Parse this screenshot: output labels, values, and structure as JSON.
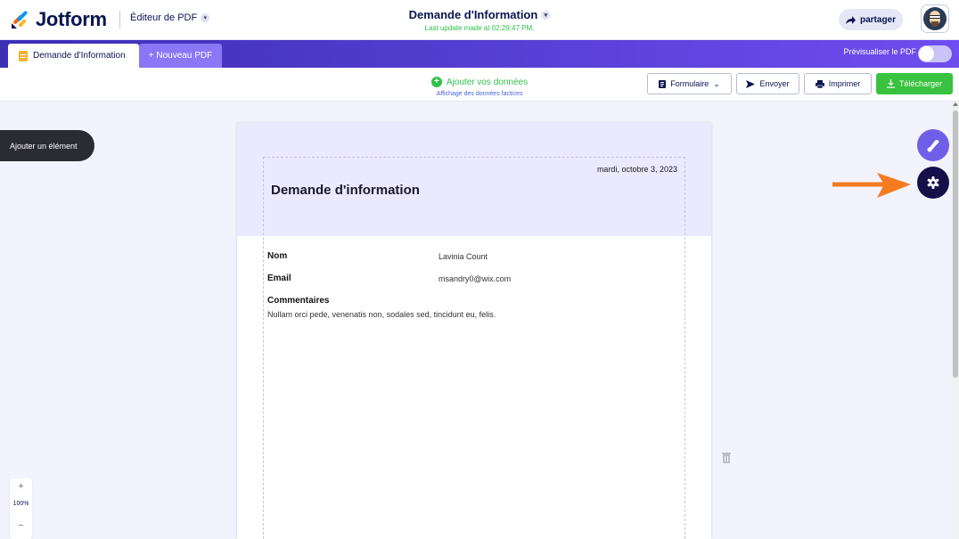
{
  "header": {
    "logo_text": "Jotform",
    "product": "Éditeur de PDF",
    "doc_title": "Demande d'Information",
    "last_update": "Last update made at 02:29:47 PM.",
    "share_label": "partager"
  },
  "tabs": {
    "active_label": "Demande d'Information",
    "new_label": "+ Nouveau PDF",
    "preview_label": "Prévisualiser le PDF"
  },
  "toolbar": {
    "add_data": "Ajouter vos données",
    "fake_data": "Affichage des données factices",
    "form_label": "Formulaire",
    "send_label": "Envoyer",
    "print_label": "Imprimer",
    "download_label": "Télécharger"
  },
  "sidebar": {
    "add_element": "Ajouter un élément",
    "zoom_plus": "+",
    "zoom_value": "100%",
    "zoom_minus": "−"
  },
  "document": {
    "date": "mardi, octobre 3, 2023",
    "title": "Demande d'information",
    "fields": [
      {
        "label": "Nom",
        "value": "Lavinia Count"
      },
      {
        "label": "Email",
        "value": "msandry0@wix.com"
      }
    ],
    "comments_label": "Commentaires",
    "comments_text": "Nullam orci pede, venenatis non, sodales sed, tincidunt eu, felis."
  },
  "colors": {
    "brand_purple": "#4d3ac7",
    "accent_green": "#39c23f",
    "annotation_arrow": "#f47b20"
  }
}
